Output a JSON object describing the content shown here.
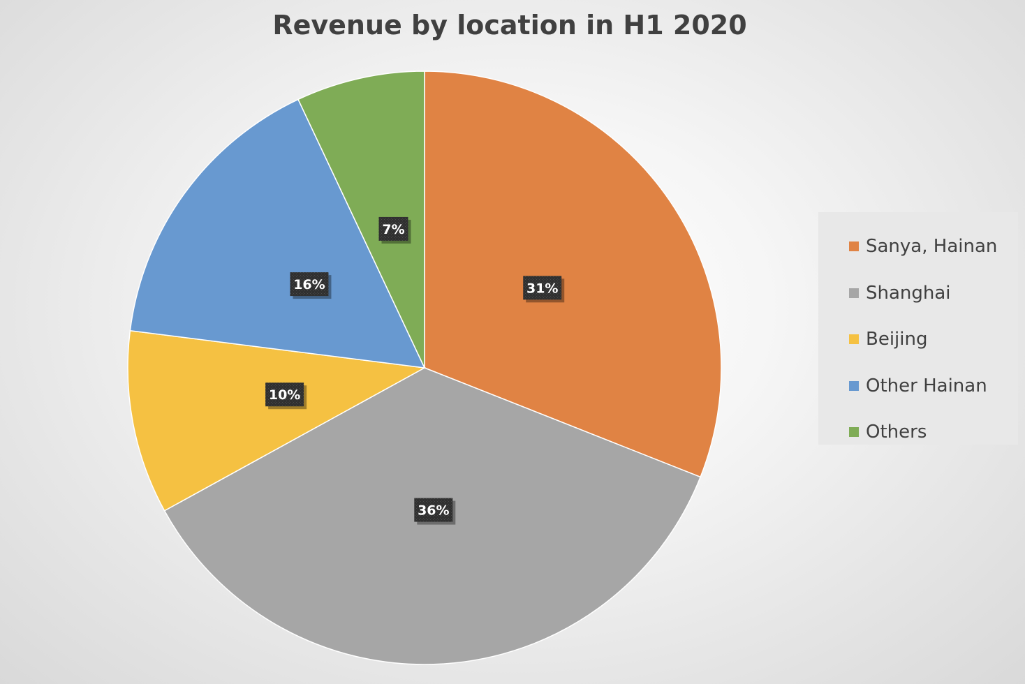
{
  "chart_data": {
    "type": "pie",
    "title": "Revenue by location in H1 2020",
    "categories": [
      "Sanya, Hainan",
      "Shanghai",
      "Beijing",
      "Other Hainan",
      "Others"
    ],
    "values": [
      31,
      36,
      10,
      16,
      7
    ],
    "labels": [
      "31%",
      "36%",
      "10%",
      "16%",
      "7%"
    ],
    "colors": [
      "#E08344",
      "#A6A6A6",
      "#F5C142",
      "#6899D0",
      "#7FAC56"
    ],
    "start_angle_deg": 0,
    "direction": "clockwise",
    "legend_position": "right"
  }
}
